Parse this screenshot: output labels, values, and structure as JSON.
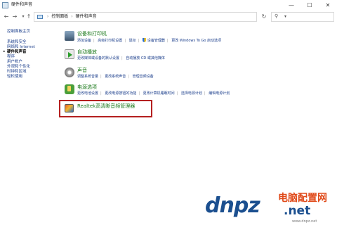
{
  "window": {
    "title": "硬件和声音",
    "min_glyph": "—",
    "max_glyph": "☐",
    "close_glyph": "✕"
  },
  "nav": {
    "back_glyph": "←",
    "forward_glyph": "→",
    "dropdown_glyph": "▾",
    "up_glyph": "↑",
    "breadcrumb": [
      "控制面板",
      "硬件和声音"
    ],
    "breadcrumb_separator": "›",
    "address_dropdown_glyph": "▾",
    "refresh_glyph": "↻",
    "search_placeholder": "",
    "search_icon": "search-icon"
  },
  "sidebar": {
    "header": "控制面板主页",
    "items": [
      {
        "label": "系统和安全",
        "current": false
      },
      {
        "label": "网络和 Internet",
        "current": false
      },
      {
        "label": "硬件和声音",
        "current": true
      },
      {
        "label": "程序",
        "current": false
      },
      {
        "label": "用户帐户",
        "current": false
      },
      {
        "label": "外观和个性化",
        "current": false
      },
      {
        "label": "时钟和区域",
        "current": false
      },
      {
        "label": "轻松使用",
        "current": false
      }
    ]
  },
  "categories": [
    {
      "title": "设备和打印机",
      "icon": "printer-icon",
      "links": [
        "添加设备",
        "高级打印机设置",
        "鼠标",
        "设备管理器",
        "更改 Windows To Go 启动选项"
      ]
    },
    {
      "title": "自动播放",
      "icon": "autoplay-icon",
      "links": [
        "更改媒体或设备的默认设置",
        "自动播放 CD 或其他媒体"
      ]
    },
    {
      "title": "声音",
      "icon": "speaker-icon",
      "links": [
        "调整系统音量",
        "更改系统声音",
        "管理音频设备"
      ]
    },
    {
      "title": "电源选项",
      "icon": "battery-icon",
      "links": [
        "更改电池设置",
        "更改电源按钮的功能",
        "更改计算机睡眠时间",
        "选择电源计划",
        "编辑电源计划"
      ]
    }
  ],
  "realtek": {
    "title": "Realtek高清晰音频管理器",
    "icon": "realtek-audio-icon",
    "highlight_color": "#b52020"
  },
  "watermark": {
    "logo": "dnpz",
    "cn": "电脑配置网",
    "net": ".net",
    "small": "www.dnpz.net"
  },
  "colors": {
    "link": "#1c3f8c",
    "category_title": "#1c7a1c"
  }
}
